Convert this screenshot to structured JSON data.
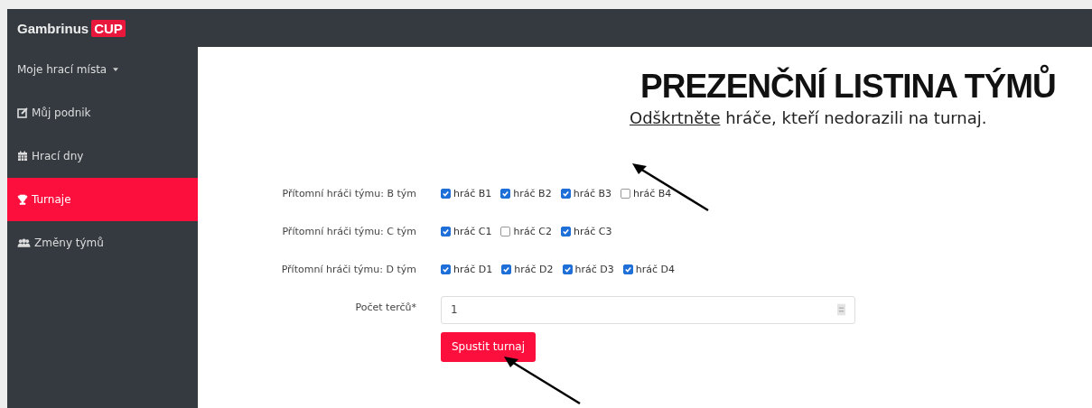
{
  "brand": {
    "name": "Gambrinus",
    "badge": "CUP"
  },
  "sidebar": {
    "items": [
      {
        "label": "Moje hrací místa",
        "dropdown": true,
        "selected": false
      },
      {
        "label": "Můj podnik",
        "dropdown": false,
        "selected": false
      },
      {
        "label": "Hrací dny",
        "dropdown": false,
        "selected": false
      },
      {
        "label": "Turnaje",
        "dropdown": false,
        "selected": true
      },
      {
        "label": "Změny týmů",
        "dropdown": false,
        "selected": false
      }
    ]
  },
  "page": {
    "title": "PREZENČNÍ LISTINA TÝMŮ",
    "subtitle_link": "Odškrtněte",
    "subtitle": "hráče, kteří nedorazili na turnaj."
  },
  "teams": [
    {
      "label": "Přítomní hráči týmu: B tým",
      "players": [
        {
          "name": "hráč B1",
          "checked": true
        },
        {
          "name": "hráč B2",
          "checked": true
        },
        {
          "name": "hráč B3",
          "checked": true
        },
        {
          "name": "hráč B4",
          "checked": false
        }
      ]
    },
    {
      "label": "Přítomní hráči týmu: C tým",
      "players": [
        {
          "name": "hráč C1",
          "checked": true
        },
        {
          "name": "hráč C2",
          "checked": false
        },
        {
          "name": "hráč C3",
          "checked": true
        }
      ]
    },
    {
      "label": "Přítomní hráči týmu: D tým",
      "players": [
        {
          "name": "hráč D1",
          "checked": true
        },
        {
          "name": "hráč D2",
          "checked": true
        },
        {
          "name": "hráč D3",
          "checked": true
        },
        {
          "name": "hráč D4",
          "checked": true
        }
      ]
    }
  ],
  "targets_field": {
    "label": "Počet terčů*",
    "value": "1"
  },
  "submit_button": {
    "label": "Spustit turnaj"
  }
}
